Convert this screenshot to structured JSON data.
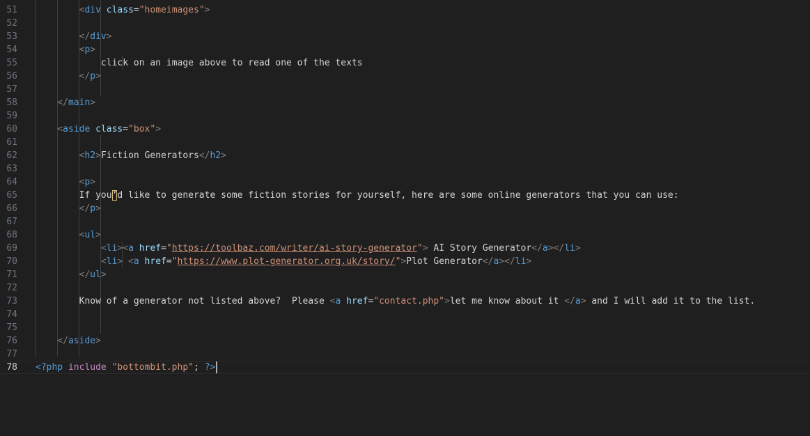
{
  "editor": {
    "active_line": "78",
    "lines": [
      {
        "n": "51",
        "tokens": [
          [
            "tag",
            "        <"
          ],
          [
            "name",
            "div"
          ],
          [
            "tag",
            " "
          ],
          [
            "attr",
            "class"
          ],
          [
            "pun",
            "="
          ],
          [
            "str",
            "\"homeimages\""
          ],
          [
            "tag",
            ">"
          ]
        ]
      },
      {
        "n": "52",
        "tokens": []
      },
      {
        "n": "53",
        "tokens": [
          [
            "tag",
            "        </"
          ],
          [
            "name",
            "div"
          ],
          [
            "tag",
            ">"
          ]
        ]
      },
      {
        "n": "54",
        "tokens": [
          [
            "tag",
            "        <"
          ],
          [
            "name",
            "p"
          ],
          [
            "tag",
            ">"
          ]
        ]
      },
      {
        "n": "55",
        "tokens": [
          [
            "text",
            "            click on an image above to read one of the texts"
          ]
        ]
      },
      {
        "n": "56",
        "tokens": [
          [
            "tag",
            "        </"
          ],
          [
            "name",
            "p"
          ],
          [
            "tag",
            ">"
          ]
        ]
      },
      {
        "n": "57",
        "tokens": []
      },
      {
        "n": "58",
        "tokens": [
          [
            "tag",
            "    </"
          ],
          [
            "name",
            "main"
          ],
          [
            "tag",
            ">"
          ]
        ]
      },
      {
        "n": "59",
        "tokens": []
      },
      {
        "n": "60",
        "tokens": [
          [
            "tag",
            "    <"
          ],
          [
            "name",
            "aside"
          ],
          [
            "tag",
            " "
          ],
          [
            "attr",
            "class"
          ],
          [
            "pun",
            "="
          ],
          [
            "str",
            "\"box\""
          ],
          [
            "tag",
            ">"
          ]
        ]
      },
      {
        "n": "61",
        "tokens": []
      },
      {
        "n": "62",
        "tokens": [
          [
            "tag",
            "        <"
          ],
          [
            "name",
            "h2"
          ],
          [
            "tag",
            ">"
          ],
          [
            "text",
            "Fiction Generators"
          ],
          [
            "tag",
            "</"
          ],
          [
            "name",
            "h2"
          ],
          [
            "tag",
            ">"
          ]
        ]
      },
      {
        "n": "63",
        "tokens": []
      },
      {
        "n": "64",
        "tokens": [
          [
            "tag",
            "        <"
          ],
          [
            "name",
            "p"
          ],
          [
            "tag",
            ">"
          ]
        ]
      },
      {
        "n": "65",
        "tokens": [
          [
            "text",
            "        If you"
          ],
          [
            "match",
            "’"
          ],
          [
            "text",
            "d like to generate some fiction stories for yourself, here are some online generators that you can use:"
          ]
        ]
      },
      {
        "n": "66",
        "tokens": [
          [
            "tag",
            "        </"
          ],
          [
            "name",
            "p"
          ],
          [
            "tag",
            ">"
          ]
        ]
      },
      {
        "n": "67",
        "tokens": []
      },
      {
        "n": "68",
        "tokens": [
          [
            "tag",
            "        <"
          ],
          [
            "name",
            "ul"
          ],
          [
            "tag",
            ">"
          ]
        ]
      },
      {
        "n": "69",
        "tokens": [
          [
            "tag",
            "            <"
          ],
          [
            "name",
            "li"
          ],
          [
            "tag",
            "><"
          ],
          [
            "name",
            "a"
          ],
          [
            "tag",
            " "
          ],
          [
            "attr",
            "href"
          ],
          [
            "pun",
            "="
          ],
          [
            "str",
            "\""
          ],
          [
            "strlink",
            "https://toolbaz.com/writer/ai-story-generator"
          ],
          [
            "str",
            "\""
          ],
          [
            "tag",
            ">"
          ],
          [
            "text",
            " AI Story Generator"
          ],
          [
            "tag",
            "</"
          ],
          [
            "name",
            "a"
          ],
          [
            "tag",
            "></"
          ],
          [
            "name",
            "li"
          ],
          [
            "tag",
            ">"
          ]
        ]
      },
      {
        "n": "70",
        "tokens": [
          [
            "tag",
            "            <"
          ],
          [
            "name",
            "li"
          ],
          [
            "tag",
            "> <"
          ],
          [
            "name",
            "a"
          ],
          [
            "tag",
            " "
          ],
          [
            "attr",
            "href"
          ],
          [
            "pun",
            "="
          ],
          [
            "str",
            "\""
          ],
          [
            "strlink",
            "https://www.plot-generator.org.uk/story/"
          ],
          [
            "str",
            "\""
          ],
          [
            "tag",
            ">"
          ],
          [
            "text",
            "Plot Generator"
          ],
          [
            "tag",
            "</"
          ],
          [
            "name",
            "a"
          ],
          [
            "tag",
            "></"
          ],
          [
            "name",
            "li"
          ],
          [
            "tag",
            ">"
          ]
        ]
      },
      {
        "n": "71",
        "tokens": [
          [
            "tag",
            "        </"
          ],
          [
            "name",
            "ul"
          ],
          [
            "tag",
            ">"
          ]
        ]
      },
      {
        "n": "72",
        "tokens": []
      },
      {
        "n": "73",
        "tokens": [
          [
            "text",
            "        Know of a generator not listed above?  Please "
          ],
          [
            "tag",
            "<"
          ],
          [
            "name",
            "a"
          ],
          [
            "tag",
            " "
          ],
          [
            "attr",
            "href"
          ],
          [
            "pun",
            "="
          ],
          [
            "str",
            "\"contact.php\""
          ],
          [
            "tag",
            ">"
          ],
          [
            "text",
            "let me know about it "
          ],
          [
            "tag",
            "</"
          ],
          [
            "name",
            "a"
          ],
          [
            "tag",
            ">"
          ],
          [
            "text",
            " and I will add it to the list."
          ]
        ]
      },
      {
        "n": "74",
        "tokens": []
      },
      {
        "n": "75",
        "tokens": []
      },
      {
        "n": "76",
        "tokens": [
          [
            "tag",
            "    </"
          ],
          [
            "name",
            "aside"
          ],
          [
            "tag",
            ">"
          ]
        ]
      },
      {
        "n": "77",
        "tokens": []
      },
      {
        "n": "78",
        "tokens": [
          [
            "php",
            "<?php"
          ],
          [
            "pun",
            " "
          ],
          [
            "kw",
            "include"
          ],
          [
            "pun",
            " "
          ],
          [
            "str",
            "\"bottombit.php\""
          ],
          [
            "pun",
            "; "
          ],
          [
            "php",
            "?>"
          ]
        ]
      }
    ]
  }
}
